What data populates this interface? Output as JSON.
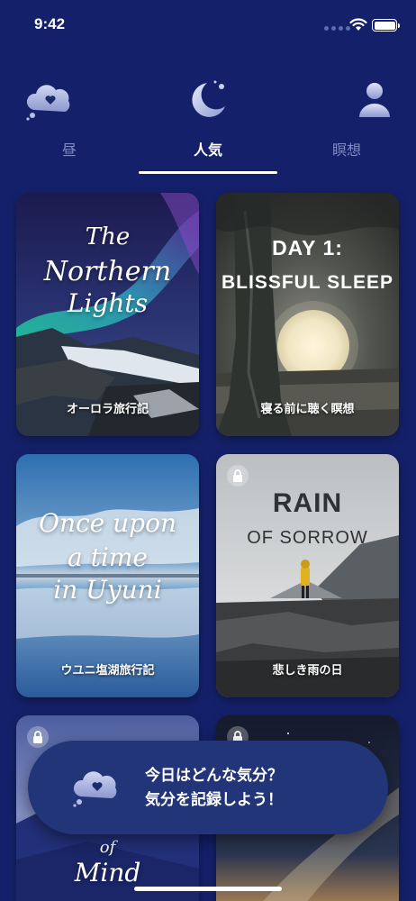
{
  "status_bar": {
    "time": "9:42"
  },
  "tabs": [
    {
      "label": "昼",
      "icon": "cloud-heart-icon",
      "active": false
    },
    {
      "label": "人気",
      "icon": "moon-icon",
      "active": true
    },
    {
      "label": "瞑想",
      "icon": "person-icon",
      "active": false
    }
  ],
  "cards": [
    {
      "title_lines": [
        "The",
        "Northern",
        "Lights"
      ],
      "caption": "オーロラ旅行記",
      "locked": false
    },
    {
      "title_lines": [
        "DAY 1:",
        "BLISSFUL SLEEP"
      ],
      "caption": "寝る前に聴く瞑想",
      "locked": false
    },
    {
      "title_lines": [
        "Once upon",
        "a time",
        "in Uyuni"
      ],
      "caption": "ウユニ塩湖旅行記",
      "locked": false
    },
    {
      "title_lines": [
        "RAIN",
        "OF SORROW"
      ],
      "caption": "悲しき雨の日",
      "locked": true
    },
    {
      "title_lines": [
        "of",
        "Mind"
      ],
      "caption": "",
      "locked": true
    },
    {
      "title_lines": [],
      "caption": "",
      "locked": true
    }
  ],
  "mood_banner": {
    "line1": "今日はどんな気分？",
    "line2": "気分を記録しよう！"
  }
}
